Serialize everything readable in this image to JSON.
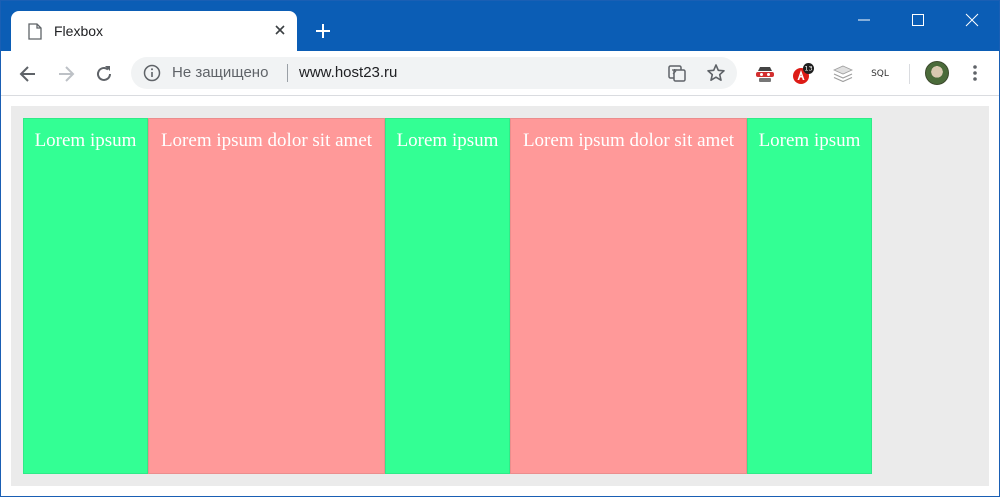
{
  "browser": {
    "tab": {
      "title": "Flexbox"
    },
    "address_bar": {
      "security_label": "Не защищено",
      "url": "www.host23.ru"
    },
    "extensions": {
      "sql_label": "SQL",
      "badge_count": "13"
    }
  },
  "page": {
    "colors": {
      "green_item": "#33ff94",
      "red_item": "#ff9999",
      "container": "#ebebeb"
    },
    "items": [
      {
        "text": "Lorem ipsum"
      },
      {
        "text": "Lorem ipsum dolor sit amet"
      },
      {
        "text": "Lorem ipsum"
      },
      {
        "text": "Lorem ipsum dolor sit amet"
      },
      {
        "text": "Lorem ipsum"
      }
    ]
  }
}
